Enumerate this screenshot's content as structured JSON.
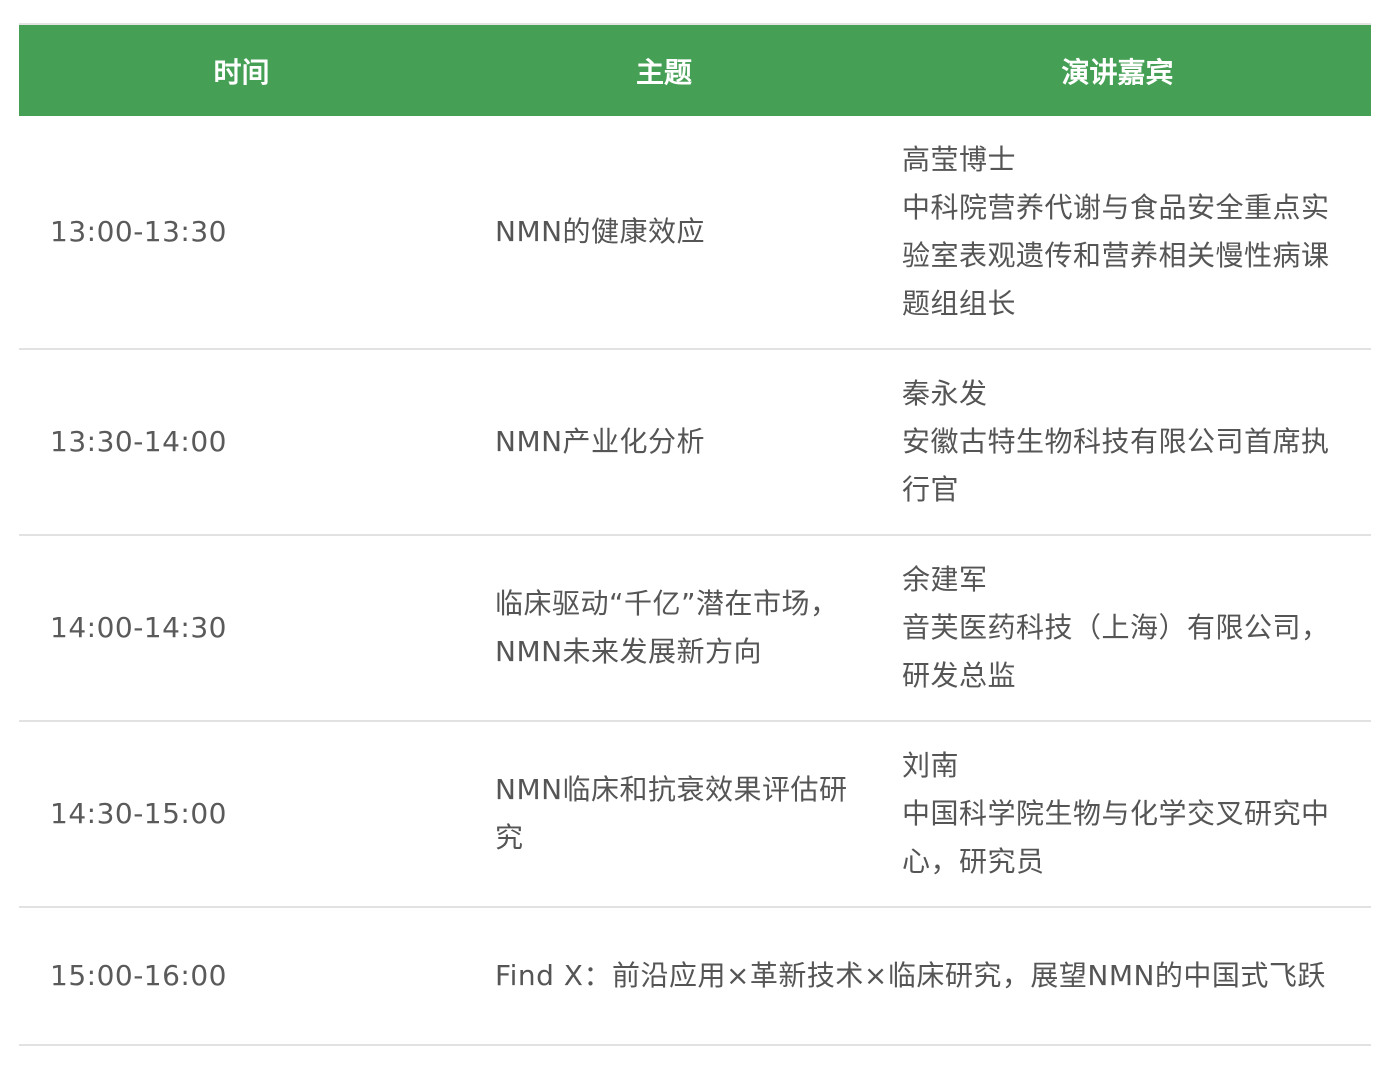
{
  "table": {
    "headers": {
      "time": "时间",
      "topic": "主题",
      "speaker": "演讲嘉宾"
    },
    "rows": [
      {
        "time": "13:00-13:30",
        "topic": "NMN的健康效应",
        "speaker_name": "高莹博士",
        "speaker_title": "中科院营养代谢与食品安全重点实验室表观遗传和营养相关慢性病课题组组长"
      },
      {
        "time": "13:30-14:00",
        "topic": "NMN产业化分析",
        "speaker_name": "秦永发",
        "speaker_title": "安徽古特生物科技有限公司首席执行官"
      },
      {
        "time": "14:00-14:30",
        "topic": "临床驱动“千亿”潜在市场，NMN未来发展新方向",
        "speaker_name": "余建军",
        "speaker_title": "音芙医药科技（上海）有限公司，研发总监"
      },
      {
        "time": "14:30-15:00",
        "topic": "NMN临床和抗衰效果评估研究",
        "speaker_name": "刘南",
        "speaker_title": "中国科学院生物与化学交叉研究中心，研究员"
      },
      {
        "time": "15:00-16:00",
        "topic": "Find X：前沿应用×革新技术×临床研究，展望NMN的中国式飞跃"
      }
    ]
  }
}
